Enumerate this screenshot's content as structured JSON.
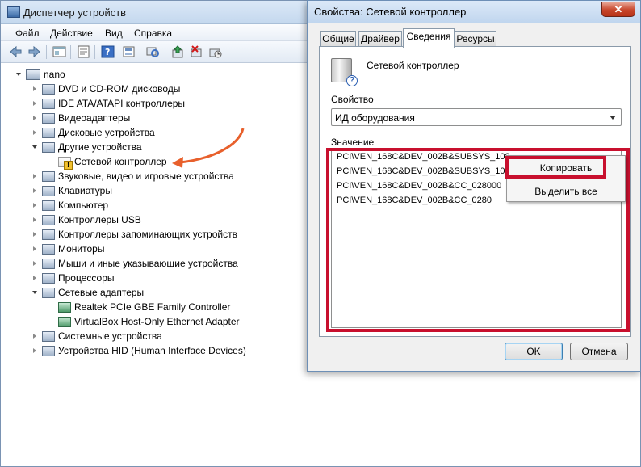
{
  "device_manager": {
    "title": "Диспетчер устройств",
    "menu": [
      "Файл",
      "Действие",
      "Вид",
      "Справка"
    ],
    "toolbar_icons": [
      "back-icon",
      "forward-icon",
      "show-hide-icon",
      "properties-icon",
      "help-icon",
      "view-icon",
      "update-driver-icon",
      "disable-icon",
      "uninstall-icon",
      "scan-icon"
    ],
    "tree": {
      "root": "nano",
      "items": [
        {
          "label": "DVD и CD-ROM дисководы",
          "state": "collapsed",
          "level": 1
        },
        {
          "label": "IDE ATA/ATAPI контроллеры",
          "state": "collapsed",
          "level": 1
        },
        {
          "label": "Видеоадаптеры",
          "state": "collapsed",
          "level": 1
        },
        {
          "label": "Дисковые устройства",
          "state": "collapsed",
          "level": 1
        },
        {
          "label": "Другие устройства",
          "state": "expanded",
          "level": 1
        },
        {
          "label": "Сетевой контроллер",
          "state": "leaf-warning",
          "level": 2
        },
        {
          "label": "Звуковые, видео и игровые устройства",
          "state": "collapsed",
          "level": 1
        },
        {
          "label": "Клавиатуры",
          "state": "collapsed",
          "level": 1
        },
        {
          "label": "Компьютер",
          "state": "collapsed",
          "level": 1
        },
        {
          "label": "Контроллеры USB",
          "state": "collapsed",
          "level": 1
        },
        {
          "label": "Контроллеры запоминающих устройств",
          "state": "collapsed",
          "level": 1
        },
        {
          "label": "Мониторы",
          "state": "collapsed",
          "level": 1
        },
        {
          "label": "Мыши и иные указывающие устройства",
          "state": "collapsed",
          "level": 1
        },
        {
          "label": "Процессоры",
          "state": "collapsed",
          "level": 1
        },
        {
          "label": "Сетевые адаптеры",
          "state": "expanded",
          "level": 1
        },
        {
          "label": "Realtek PCIe GBE Family Controller",
          "state": "leaf-net",
          "level": 2
        },
        {
          "label": "VirtualBox Host-Only Ethernet Adapter",
          "state": "leaf-net",
          "level": 2
        },
        {
          "label": "Системные устройства",
          "state": "collapsed",
          "level": 1
        },
        {
          "label": "Устройства HID (Human Interface Devices)",
          "state": "collapsed",
          "level": 1
        }
      ]
    }
  },
  "properties_dialog": {
    "title": "Свойства: Сетевой контроллер",
    "close_glyph": "✕",
    "tabs": [
      "Общие",
      "Драйвер",
      "Сведения",
      "Ресурсы"
    ],
    "active_tab": "Сведения",
    "device_name": "Сетевой контроллер",
    "property_label": "Свойство",
    "property_value": "ИД оборудования",
    "value_label": "Значение",
    "values": [
      "PCI\\VEN_168C&DEV_002B&SUBSYS_108",
      "PCI\\VEN_168C&DEV_002B&SUBSYS_108",
      "PCI\\VEN_168C&DEV_002B&CC_028000",
      "PCI\\VEN_168C&DEV_002B&CC_0280"
    ],
    "context_menu": [
      "Копировать",
      "Выделить все"
    ],
    "ok_label": "OK",
    "cancel_label": "Отмена"
  },
  "annotation_colors": {
    "highlight": "#c8102e",
    "arrow": "#e8602c"
  }
}
